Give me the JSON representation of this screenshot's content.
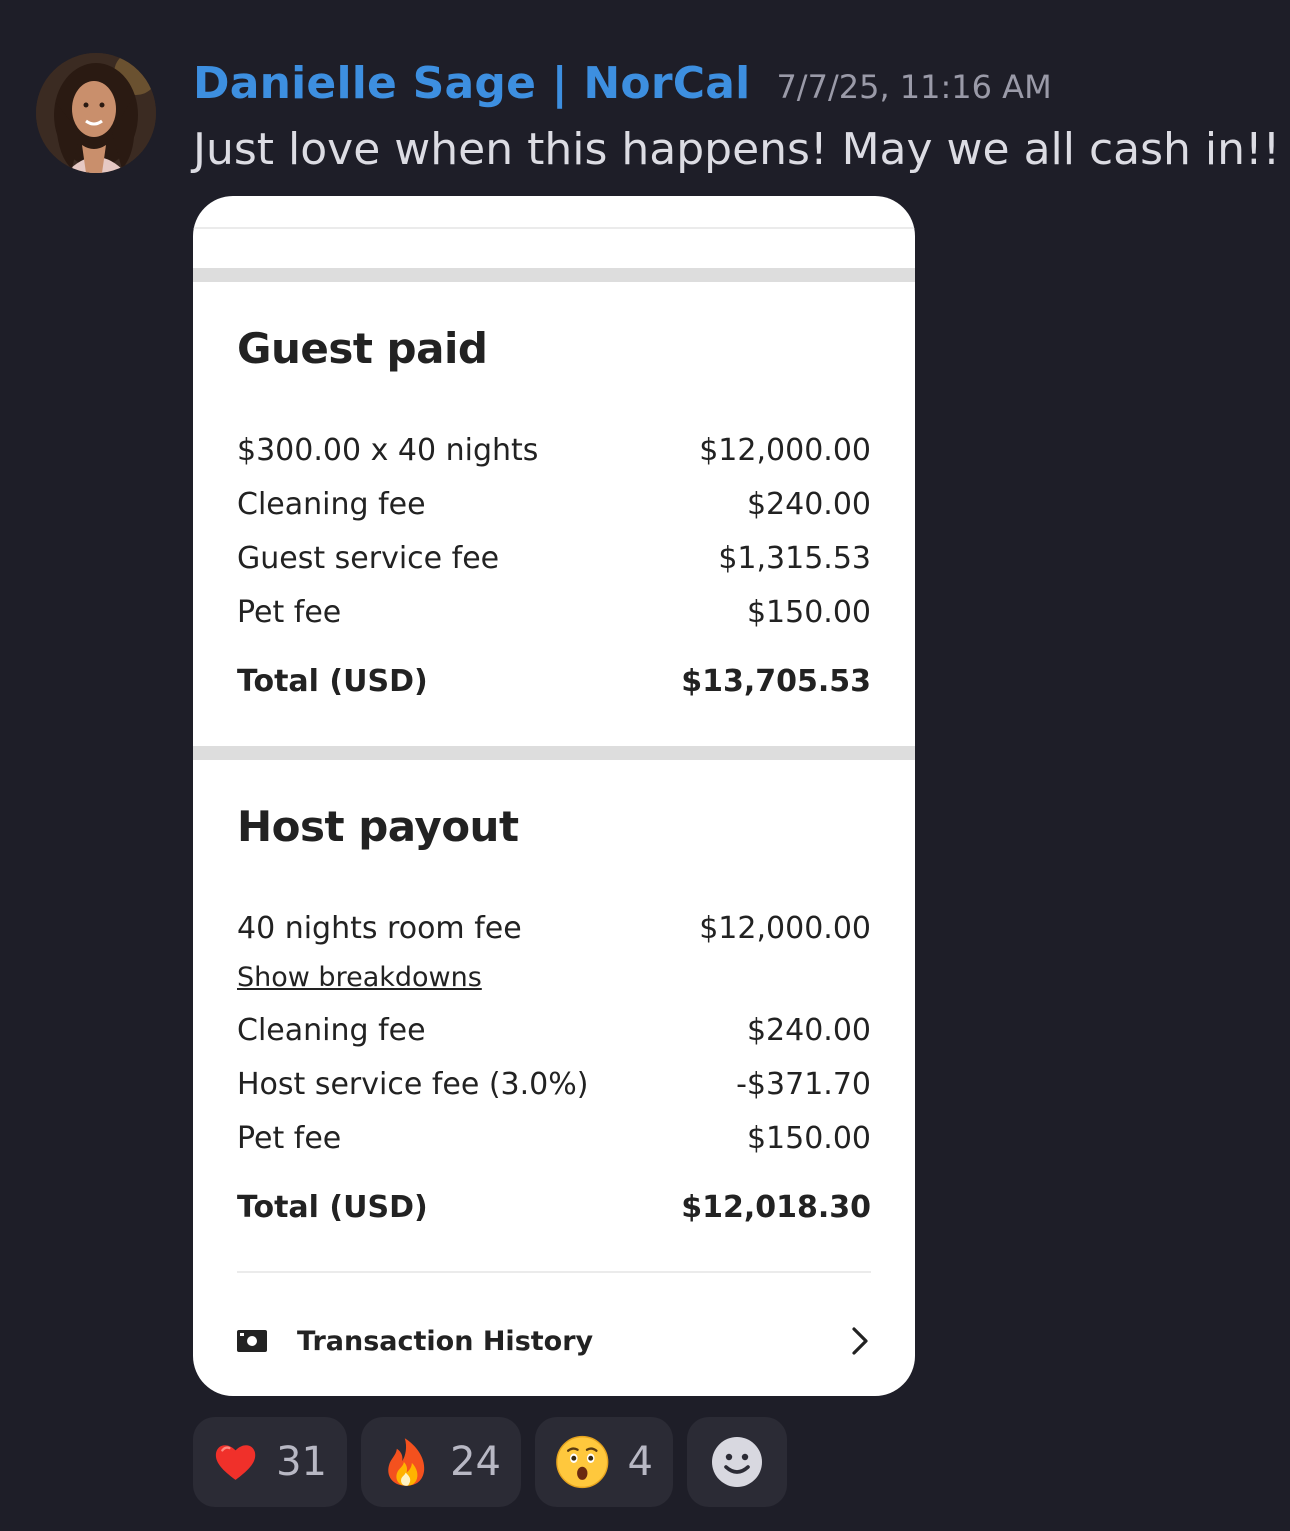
{
  "message": {
    "author": "Danielle Sage | NorCal",
    "timestamp": "7/7/25, 11:16 AM",
    "text": "Just love when this happens! May we all cash in!!",
    "text_emoji": "smiling-face-emoji"
  },
  "card": {
    "guest_paid": {
      "title": "Guest paid",
      "rows": [
        {
          "label": "$300.00 x 40 nights",
          "value": "$12,000.00"
        },
        {
          "label": "Cleaning fee",
          "value": "$240.00"
        },
        {
          "label": "Guest service fee",
          "value": "$1,315.53"
        },
        {
          "label": "Pet fee",
          "value": "$150.00"
        }
      ],
      "total": {
        "label": "Total (USD)",
        "value": "$13,705.53"
      }
    },
    "host_payout": {
      "title": "Host payout",
      "room_fee": {
        "label": "40 nights room fee",
        "value": "$12,000.00"
      },
      "breakdown_link": "Show breakdowns",
      "rows": [
        {
          "label": "Cleaning fee",
          "value": "$240.00"
        },
        {
          "label": "Host service fee (3.0%)",
          "value": "-$371.70"
        },
        {
          "label": "Pet fee",
          "value": "$150.00"
        }
      ],
      "total": {
        "label": "Total (USD)",
        "value": "$12,018.30"
      }
    },
    "transaction_history": {
      "label": "Transaction History",
      "icon": "cash-icon",
      "chevron": "chevron-right-icon"
    }
  },
  "reactions": [
    {
      "emoji": "red-heart",
      "count": "31"
    },
    {
      "emoji": "fire",
      "count": "24"
    },
    {
      "emoji": "hushed-face",
      "count": "4"
    }
  ],
  "add_reaction_icon": "add-reaction-icon",
  "colors": {
    "background": "#1e1e28",
    "author": "#3d8fe0",
    "reaction_bg": "#2b2b35"
  }
}
